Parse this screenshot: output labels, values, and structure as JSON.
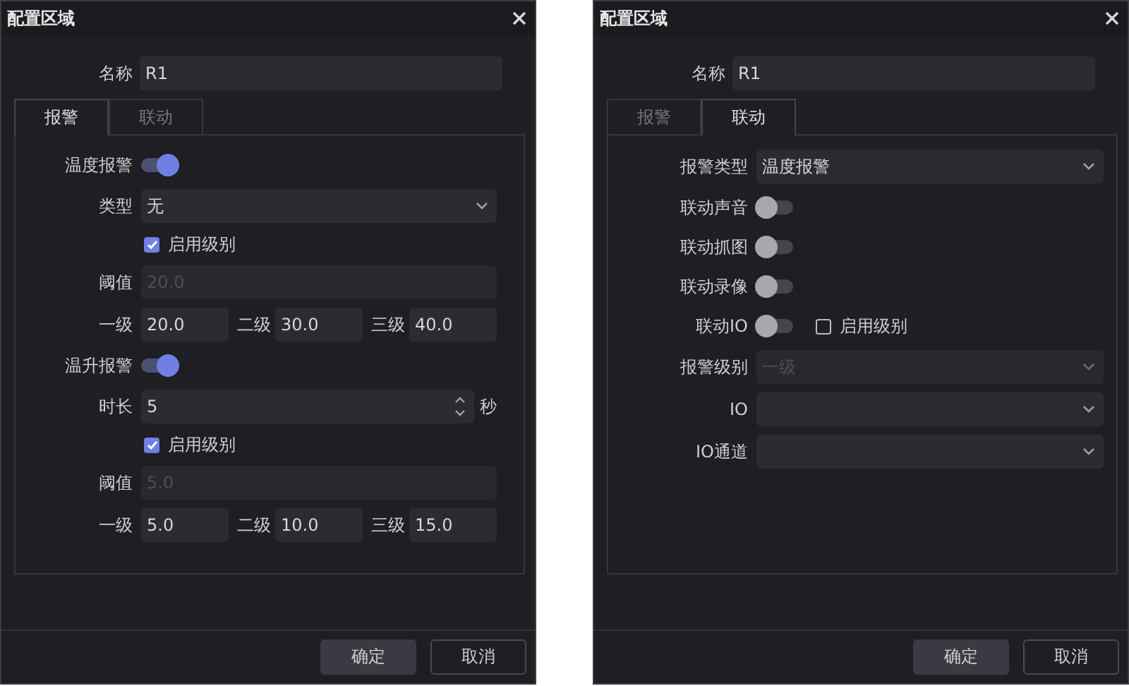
{
  "dialogs": [
    {
      "title": "配置区域",
      "name": {
        "label": "名称",
        "value": "R1"
      },
      "tabs": [
        {
          "label": "报警",
          "selected": true
        },
        {
          "label": "联动",
          "selected": false
        }
      ],
      "rows": [
        {
          "kind": "toggle",
          "label": "温度报警",
          "on": true
        },
        {
          "kind": "select",
          "label": "类型",
          "value": "无",
          "disabled": false
        },
        {
          "kind": "checkbox",
          "label": "启用级别",
          "checked": true
        },
        {
          "kind": "text",
          "label": "阈值",
          "value": "20.0",
          "disabled": true
        },
        {
          "kind": "levels",
          "items": [
            {
              "label": "一级",
              "value": "20.0"
            },
            {
              "label": "二级",
              "value": "30.0"
            },
            {
              "label": "三级",
              "value": "40.0"
            }
          ]
        },
        {
          "kind": "toggle",
          "label": "温升报警",
          "on": true
        },
        {
          "kind": "spinner",
          "label": "时长",
          "value": "5",
          "unit": "秒"
        },
        {
          "kind": "checkbox",
          "label": "启用级别",
          "checked": true
        },
        {
          "kind": "text",
          "label": "阈值",
          "value": "5.0",
          "disabled": true
        },
        {
          "kind": "levels",
          "items": [
            {
              "label": "一级",
              "value": "5.0"
            },
            {
              "label": "二级",
              "value": "10.0"
            },
            {
              "label": "三级",
              "value": "15.0"
            }
          ]
        }
      ],
      "buttons": [
        {
          "label": "确定",
          "kind": "primary"
        },
        {
          "label": "取消",
          "kind": "secondary"
        }
      ]
    },
    {
      "title": "配置区域",
      "name": {
        "label": "名称",
        "value": "R1"
      },
      "tabs": [
        {
          "label": "报警",
          "selected": false
        },
        {
          "label": "联动",
          "selected": true
        }
      ],
      "rows": [
        {
          "kind": "select",
          "label": "报警类型",
          "value": "温度报警",
          "disabled": false
        },
        {
          "kind": "toggle",
          "label": "联动声音",
          "on": false
        },
        {
          "kind": "toggle",
          "label": "联动抓图",
          "on": false
        },
        {
          "kind": "toggle",
          "label": "联动录像",
          "on": false
        },
        {
          "kind": "toggle",
          "label": "联动IO",
          "on": false,
          "checkbox": {
            "label": "启用级别",
            "checked": false
          }
        },
        {
          "kind": "select",
          "label": "报警级别",
          "value": "一级",
          "disabled": true
        },
        {
          "kind": "select",
          "label": "IO",
          "disabled": false
        },
        {
          "kind": "select",
          "label": "IO通道",
          "disabled": false
        }
      ],
      "buttons": [
        {
          "label": "确定",
          "kind": "primary"
        },
        {
          "label": "取消",
          "kind": "secondary"
        }
      ]
    }
  ]
}
